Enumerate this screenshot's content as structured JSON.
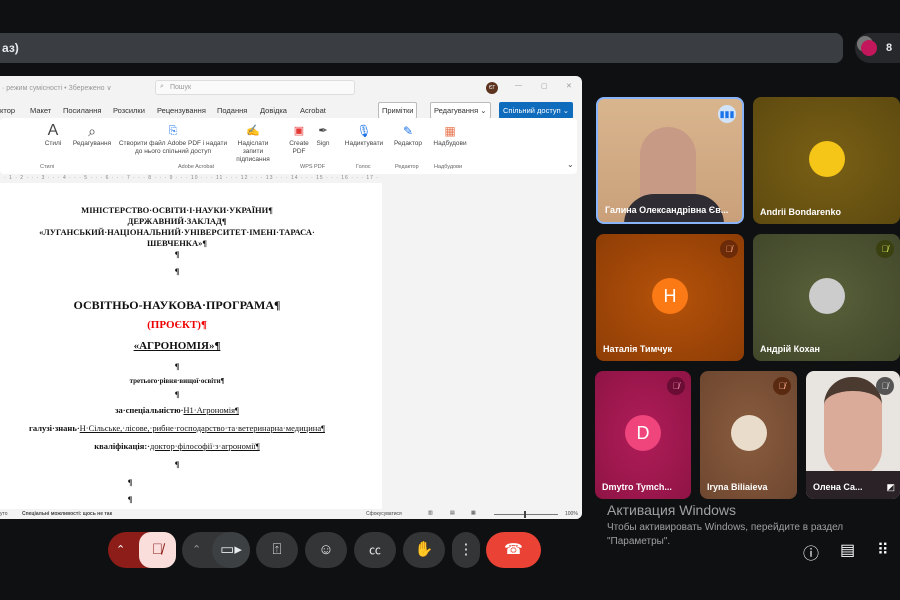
{
  "meet": {
    "presentation_title": "аз)",
    "participant_count": "8"
  },
  "word": {
    "title": "· режим сумісності • Збережено ∨",
    "search_placeholder": "Пошук",
    "user_initials": "ЄГ",
    "menu": [
      "ктор",
      "Макет",
      "Посилання",
      "Розсилки",
      "Рецензування",
      "Подання",
      "Довідка",
      "Acrobat"
    ],
    "comments_btn": "Примітки",
    "editing_btn": "Редагування ⌄",
    "share_btn": "Спільний доступ ⌄",
    "ribbon": {
      "styles": "Стилі",
      "editing": "Редагування",
      "create_pdf": "Створити файл Adobe PDF і надати до нього спільний доступ",
      "request_sign": "Надіслати запити підписання",
      "create": "Create PDF",
      "sign": "Sign",
      "dictate": "Надиктувати",
      "editor": "Редактор",
      "addins": "Надбудови",
      "groups": {
        "styles": "Стилі",
        "acrobat": "Adobe Acrobat",
        "wps": "WPS PDF",
        "voice": "Голос",
        "editor": "Редактор",
        "addins": "Надбудови"
      }
    },
    "ruler": "· 1 · 2 · · · 3 · · · 4 · · · 5 · · · 6 · · · 7 · · · 8 · · · 9 · · · 10 · · · 11 · · · 12 · · · 13 · · · 14 · · · 15 · · · 16 · · · 17 ·",
    "doc": {
      "l1": "МІНІСТЕРСТВО·ОСВІТИ·І·НАУКИ·УКРАЇНИ¶",
      "l2": "ДЕРЖАВНИЙ·ЗАКЛАД¶",
      "l3": "«ЛУГАНСЬКИЙ·НАЦІОНАЛЬНИЙ·УНІВЕРСИТЕТ·ІМЕНІ·ТАРАСА·",
      "l4": "ШЕВЧЕНКА»¶",
      "pil": "¶",
      "title": "ОСВІТНЬО-НАУКОВА·ПРОГРАМА¶",
      "draft": "(ПРОЄКТ)¶",
      "name": "«АГРОНОМІЯ»¶",
      "level": "третього·рівня·вищої·освіти¶",
      "spec_label": "за·спеціальністю·",
      "spec": "Н1·Агрономія¶",
      "field_label": "галузі·знань·",
      "field": "Н·Сільське,·лісове,·рибне·господарство·та·ветеринарна·медицина¶",
      "qual_label": "кваліфікація:·",
      "qual": "доктор·філософії·з·агрономії¶"
    },
    "status": {
      "left": "уто",
      "accessibility": "Спеціальні можливості: щось не так",
      "focus": "Сфокусуватися",
      "zoom": "100%"
    }
  },
  "participants": [
    {
      "name": "Галина Олександрівна Єв...",
      "speaking": true
    },
    {
      "name": "Andrii Bondarenko"
    },
    {
      "name": "Наталія Тимчук",
      "initial": "Н"
    },
    {
      "name": "Андрій Кохан"
    },
    {
      "name": "Dmytro Tymch...",
      "initial": "D"
    },
    {
      "name": "Iryna Biliaieva"
    },
    {
      "name": "Олена Са..."
    }
  ],
  "watermark": {
    "title": "Активация Windows",
    "text": "Чтобы активировать Windows, перейдите в раздел \"Параметры\"."
  },
  "colors": {
    "end_call": "#ea4335",
    "speaking_border": "#8ab4f8"
  }
}
